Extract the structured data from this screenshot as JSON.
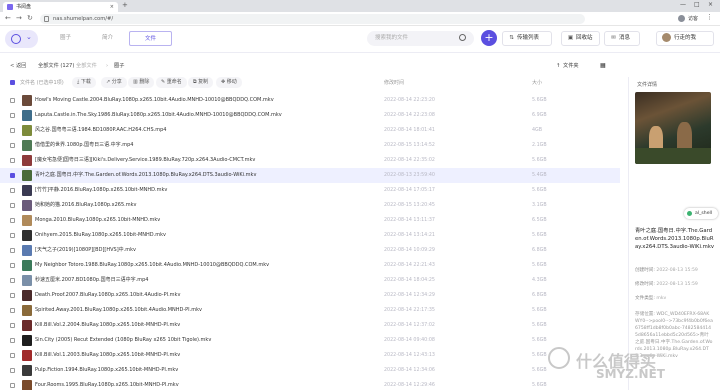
{
  "browser": {
    "tab_title": "书阅盘",
    "tab_close": "×",
    "new_tab": "+",
    "url": "nas.shumelpan.com/#/",
    "user_label": "访客",
    "back": "←",
    "forward": "→",
    "reload": "↻",
    "minimize": "—",
    "maximize": "□",
    "close": "×",
    "menu": "⋮"
  },
  "header": {
    "tabs": [
      "圈子",
      "简介",
      "文件"
    ],
    "active_tab": "文件",
    "search_placeholder": "搜索我的文件",
    "plus": "+",
    "buttons": {
      "transfer": "传输列表",
      "recycle": "回收站",
      "messages": "消息",
      "user": "行走的我"
    },
    "accent": "#5b4fe0"
  },
  "crumbs": {
    "back": "< 返回",
    "all_files": "全部文件 (127)",
    "all_files2": "全部文件",
    "current": "圈子",
    "upload": "文件夹",
    "view_icon": "▦"
  },
  "actions": {
    "col_name": "文件名 (已选中1项)",
    "download": "下载",
    "share": "分享",
    "delete": "删除",
    "rename": "重命名",
    "copy": "复制",
    "move": "移动",
    "col_date": "修改时间",
    "col_size": "大小"
  },
  "files": [
    {
      "name": "Howl's Moving Castle.2004.BluRay.1080p.x265.10bit.4Audio.MNHD-10010@BBQDDQ.COM.mkv",
      "date": "2022-08-14 22:23:20",
      "size": "5.6GB",
      "color": "#6b4a3a",
      "checked": false,
      "selected": false
    },
    {
      "name": "Laputa.Castle.in.The.Sky.1986.BluRay.1080p.x265.10bit.4Audio.MNHD-10010@BBQDDQ.COM.mkv",
      "date": "2022-08-14 22:23:08",
      "size": "6.9GB",
      "color": "#3e6d8a",
      "checked": false,
      "selected": false
    },
    {
      "name": "风之谷.国粤粤三语.1984.BD1080P.AAC.H264.CHS.mp4",
      "date": "2022-08-14 18:01:41",
      "size": "4GB",
      "color": "#7d8b3b",
      "checked": false,
      "selected": false
    },
    {
      "name": "借借里的世界.1080p.国粤日三语.中字.mp4",
      "date": "2022-08-15 13:14:52",
      "size": "2.1GB",
      "color": "#4f7a55",
      "checked": false,
      "selected": false
    },
    {
      "name": "[魔女宅急便]国粤日三语][Kiki's.Delivery.Service.1989.BluRay.720p.x264.3Audio-CMCT.mkv",
      "date": "2022-08-14 22:35:02",
      "size": "5.6GB",
      "color": "#8e3b3b",
      "checked": false,
      "selected": false
    },
    {
      "name": "青叶之庭.国粤日.中字.The.Garden.of.Words.2013.1080p.BluRay.x264.DTS.3audio-WiKi.mkv",
      "date": "2022-08-13 23:59:40",
      "size": "5.4GB",
      "color": "#4a6b3a",
      "checked": true,
      "selected": true
    },
    {
      "name": "[竹竹]平静.2016.BluRay.1080p.x265.10bit-MNHD.mkv",
      "date": "2022-08-14 17:05:17",
      "size": "5.6GB",
      "color": "#3a3a52",
      "checked": false,
      "selected": false
    },
    {
      "name": "她和她的猫.2016.BluRay.1080p.x265.mkv",
      "date": "2022-08-15 13:20:45",
      "size": "3.1GB",
      "color": "#6a5a7a",
      "checked": false,
      "selected": false
    },
    {
      "name": "Monga.2010.BluRay.1080p.x265.10bit-MNHD.mkv",
      "date": "2022-08-14 13:11:37",
      "size": "6.5GB",
      "color": "#b08a5a",
      "checked": false,
      "selected": false
    },
    {
      "name": "Onihyem.2015.BluRay.1080p.x265.10bit-MNHD.mkv",
      "date": "2022-08-14 13:14:21",
      "size": "5.6GB",
      "color": "#2f2f2f",
      "checked": false,
      "selected": false
    },
    {
      "name": "[天气之子(2019)[1080P][BD][HVS]中.mkv",
      "date": "2022-08-14 10:09:29",
      "size": "6.8GB",
      "color": "#5a7ab0",
      "checked": false,
      "selected": false
    },
    {
      "name": "My Neighbor Totoro.1988.BluRay.1080p.x265.10bit.4Audio.MNHD-10010@BBQDDQ.COM.mkv",
      "date": "2022-08-14 22:21:43",
      "size": "5.6GB",
      "color": "#3b7a5a",
      "checked": false,
      "selected": false
    },
    {
      "name": "秒速五厘米.2007.BD1080p.国粤日三语中字.mp4",
      "date": "2022-08-14 18:04:25",
      "size": "4.3GB",
      "color": "#7a8fa8",
      "checked": false,
      "selected": false
    },
    {
      "name": "Death.Proof.2007.BluRay.1080p.x265.10bit.4Audio-PI.mkv",
      "date": "2022-08-14 12:34:29",
      "size": "6.8GB",
      "color": "#4a2a2a",
      "checked": false,
      "selected": false
    },
    {
      "name": "Spirited.Away.2001.BluRay.1080p.x265.10bit.4Audio.MNHD-PI.mkv",
      "date": "2022-08-14 22:17:35",
      "size": "5.6GB",
      "color": "#8a6a3a",
      "checked": false,
      "selected": false
    },
    {
      "name": "Kill.Bill.Vol.2.2004.BluRay.1080p.x265.10bit-MNHD-PI.mkv",
      "date": "2022-08-14 12:37:02",
      "size": "5.6GB",
      "color": "#6a2a2a",
      "checked": false,
      "selected": false
    },
    {
      "name": "Sin.City (2005) Recut Extended (1080p BluRay x265 10bit Tigole).mkv",
      "date": "2022-08-14 09:40:08",
      "size": "5.6GB",
      "color": "#1e1e1e",
      "checked": false,
      "selected": false
    },
    {
      "name": "Kill.Bill.Vol.1.2003.BluRay.1080p.x265.10bit-MNHD-PI.mkv",
      "date": "2022-08-14 12:43:13",
      "size": "5.6GB",
      "color": "#a02a2a",
      "checked": false,
      "selected": false
    },
    {
      "name": "Pulp.Fiction.1994.BluRay.1080p.x265.10bit-MNHD-PI.mkv",
      "date": "2022-08-14 12:34:06",
      "size": "5.6GB",
      "color": "#3a3a3a",
      "checked": false,
      "selected": false
    },
    {
      "name": "Four.Rooms.1995.BluRay.1080p.x265.10bit-MNHD-PI.mkv",
      "date": "2022-08-14 12:29:46",
      "size": "5.6GB",
      "color": "#7a4a2a",
      "checked": false,
      "selected": false
    }
  ],
  "panel": {
    "title": "文件详情",
    "name": "青叶之庭.国粤日.中字.The.Garden.of.Words.2013.1080p.BluRay.x264.DTS.3audio-WiKi.mkv",
    "created_label": "创建时间:",
    "created": "2022-08-13 15:59",
    "modified_label": "修改时间:",
    "modified": "2022-08-13 15:59",
    "type_label": "文件类型:",
    "type": "mkv",
    "info": "存储位置: WDC_WD40EFRX-68AKWY0-->pool0-->73bc9f4b0b0f6ea6758ff1db8f0b0abc-74825844145d8656a11ebbd5c20d565>青叶之庭.国粤日.中字.The.Garden.of.Words.2013.1080p.BluRay.x264.DTS.3audio-WiKi.mkv"
  },
  "shell_badge": "al_shell",
  "watermark": {
    "big": "什么值得买",
    "small": "SMYZ.NET"
  }
}
